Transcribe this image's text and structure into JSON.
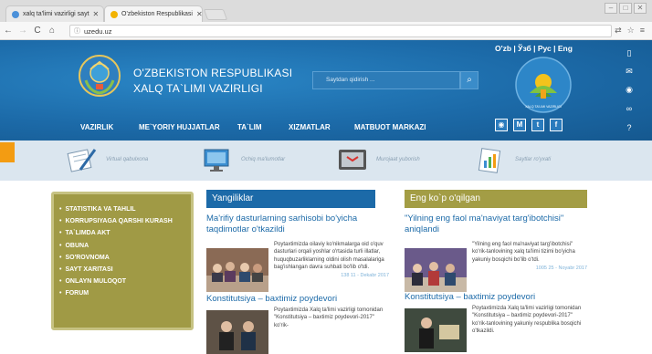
{
  "browser": {
    "tabs": [
      {
        "title": "xalq ta'limi vazirligi sayt",
        "close": "✕"
      },
      {
        "title": "O'zbekiston Respublikasi",
        "close": "✕"
      }
    ],
    "url": "uzedu.uz",
    "window_buttons": [
      "–",
      "□",
      "✕"
    ]
  },
  "header": {
    "title_line1": "O'ZBEKISTON RESPUBLIKASI",
    "title_line2": "XALQ TA`LIMI VAZIRLIGI",
    "search_placeholder": "Saytdan qidirish ...",
    "languages": "O'zb  | Ўзб | Рус | Eng",
    "logo_caption": "XALQ TA'LIMI VAZIRLIGI",
    "nav": [
      "VAZIRLIK",
      "ME`YORIY HUJJATLAR",
      "TA`LIM",
      "XIZMATLAR",
      "MATBUOT MARKAZI"
    ],
    "social": [
      "M",
      "t",
      "f"
    ]
  },
  "quicklinks": [
    {
      "label": "Virtual qabulxona"
    },
    {
      "label": "Ochiq ma'lumotlar"
    },
    {
      "label": "Murojaat yuborish"
    },
    {
      "label": "Saytlar ro'yxati"
    }
  ],
  "leftmenu": [
    "STATISTIKA VA TAHLIL",
    "KORRUPSIYAGA QARSHI KURASH",
    "TA`LIMDA AKT",
    "OBUNA",
    "SO'ROVNOMA",
    "SAYT XARITASI",
    "ONLAYN MULOQOT",
    "FORUM"
  ],
  "news": {
    "heading": "Yangiliklar",
    "articles": [
      {
        "title": "Ma'rifiy dasturlarning sarhisobi bo'yicha taqdimotlar o'tkazildi",
        "text": "Poytaxtimizda oilaviy ko'nikmalarga oid o'quv dasturlari orqali yoshlar o'rtasida turli illatlar, huquqbuzarliklarning oldini olish masalalariga bag'ishlangan davra suhbati bo'lib o'tdi.",
        "meta": "138   11 - Dekabr 2017"
      },
      {
        "title": "Konstitutsiya – baxtimiz poydevori",
        "text": "Poytaxtimizda Xalq ta'limi vazirligi tomonidan \"Konstitutsiya – baxtimiz poydevori-2017\" ko'rik-"
      }
    ]
  },
  "popular": {
    "heading": "Eng ko`p o'qilgan",
    "articles": [
      {
        "title": "\"Yilning eng faol ma'naviyat targ'ibotchisi\" aniqlandi",
        "text": "\"Yilning eng faol ma'naviyat targ'ibotchisi\" ko'rik-tanlovining xalq ta'limi tizimi bo'yicha yakuniy bosqichi bo'lib o'tdi.",
        "meta": "1005   25 - Noyabr 2017"
      },
      {
        "title": "Konstitutsiya – baxtimiz poydevori",
        "text": "Poytaxtimizda Xalq ta'limi vazirligi tomonidan \"Konstitutsiya – baxtimiz poydevori-2017\" ko'rik-tanlovining yakuniy respublika bosqichi o'tkazildi."
      }
    ]
  },
  "colors": {
    "header_blue": "#1c6aa8",
    "olive": "#a09a45",
    "link_blue": "#1c6aa8",
    "quicklinks_bg": "#dbe6ef"
  }
}
